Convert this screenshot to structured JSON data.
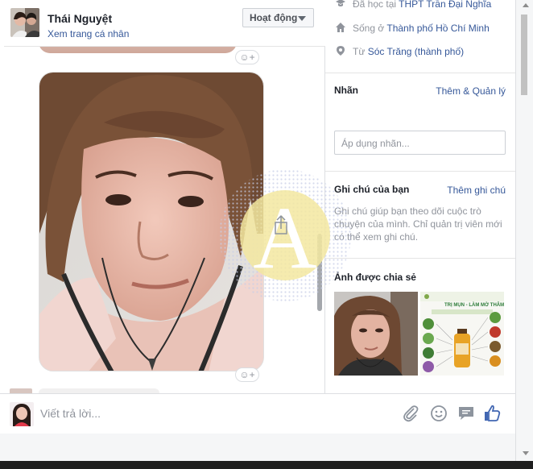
{
  "header": {
    "name": "Thái Nguyệt",
    "profile_link": "Xem trang cá nhân",
    "status_button": "Hoạt động"
  },
  "conversation": {
    "reaction_icon": "smiley-plus-icon",
    "composer_placeholder": "Viết trả lời..."
  },
  "composer_tools": [
    "paperclip-icon",
    "emoji-icon",
    "sticker-icon",
    "like-icon"
  ],
  "info": {
    "studied_prefix": "Đã học tại",
    "studied_link": "THPT Trần Đại Nghĩa",
    "lives_prefix": "Sống ở",
    "lives_link": "Thành phố Hồ Chí Minh",
    "from_prefix": "Từ",
    "from_link": "Sóc Trăng (thành phố)"
  },
  "labels": {
    "title": "Nhãn",
    "manage_link": "Thêm & Quản lý",
    "input_placeholder": "Áp dụng nhãn..."
  },
  "notes": {
    "title": "Ghi chú của bạn",
    "add_link": "Thêm ghi chú",
    "description": "Ghi chú giúp bạn theo dõi cuộc trò chuyện của mình. Chỉ quản trị viên mới có thể xem ghi chú."
  },
  "shared_photos": {
    "title": "Ảnh được chia sẻ",
    "poster_heading": "TRỊ MỤN - LÀM MỜ THÂM"
  },
  "watermark": {
    "letter": "A"
  },
  "colors": {
    "link": "#365899",
    "messenger_blue": "#4267b2",
    "muted_text": "#90949c",
    "watermark_yellow": "#f3e7a0"
  }
}
